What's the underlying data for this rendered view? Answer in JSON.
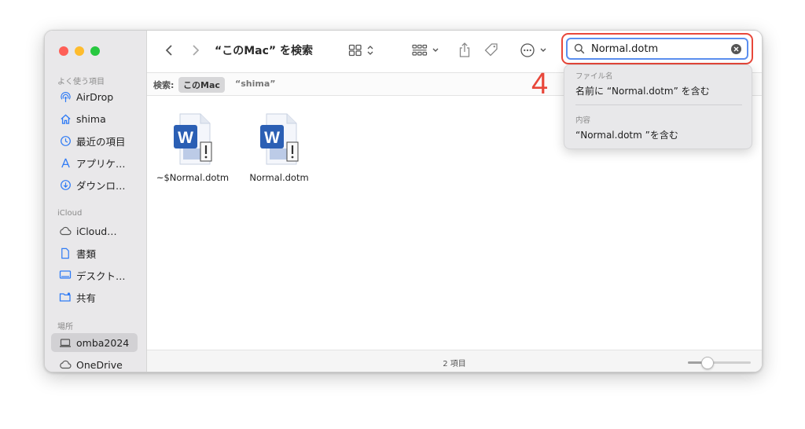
{
  "window": {
    "title": "“このMac” を検索"
  },
  "sidebar": {
    "sections": [
      {
        "label": "よく使う項目",
        "items": [
          {
            "label": "AirDrop",
            "icon": "airdrop-icon"
          },
          {
            "label": "shima",
            "icon": "home-icon"
          },
          {
            "label": "最近の項目",
            "icon": "clock-icon"
          },
          {
            "label": "アプリケ…",
            "icon": "applications-icon"
          },
          {
            "label": "ダウンロ…",
            "icon": "download-icon"
          }
        ]
      },
      {
        "label": "iCloud",
        "items": [
          {
            "label": "iCloud…",
            "icon": "cloud-icon"
          },
          {
            "label": "書類",
            "icon": "document-icon"
          },
          {
            "label": "デスクト…",
            "icon": "desktop-icon"
          },
          {
            "label": "共有",
            "icon": "shared-folder-icon"
          }
        ]
      },
      {
        "label": "場所",
        "items": [
          {
            "label": "omba2024",
            "icon": "laptop-icon",
            "selected": true
          },
          {
            "label": "OneDrive",
            "icon": "cloud-icon"
          }
        ]
      }
    ]
  },
  "scope": {
    "label": "検索:",
    "this_mac": "このMac",
    "user": "“shima”"
  },
  "files": [
    {
      "name": "~$Normal.dotm"
    },
    {
      "name": "Normal.dotm"
    }
  ],
  "status": {
    "count": "2 項目",
    "zoom": 0.25
  },
  "search": {
    "value": "Normal.dotm",
    "dropdown": {
      "filename_header": "ファイル名",
      "filename_option": "名前に “Normal.dotm” を含む",
      "content_header": "内容",
      "content_option": "“Normal.dotm ”を含む"
    }
  },
  "annotation": {
    "step": "4"
  },
  "colors": {
    "accent": "#5b8ff0",
    "annotation": "#e8473a",
    "word_blue": "#2b5fb4"
  }
}
